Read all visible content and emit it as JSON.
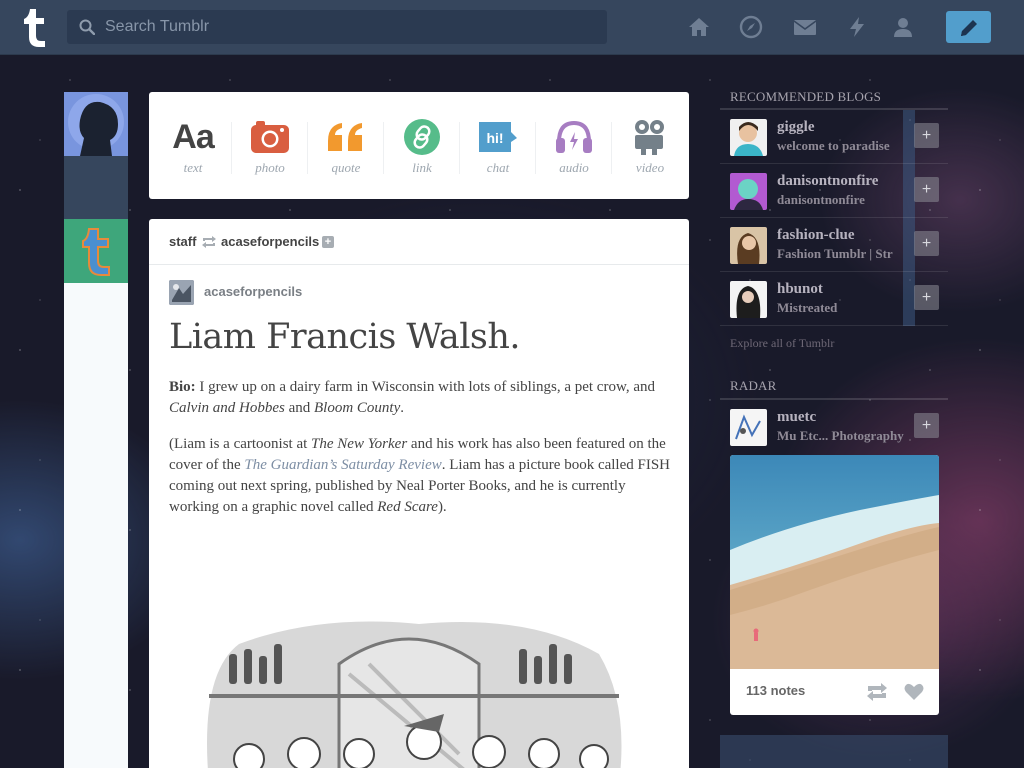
{
  "app": "Tumblr",
  "search": {
    "placeholder": "Search Tumblr"
  },
  "nav_icons": [
    "home-icon",
    "explore-compass-icon",
    "inbox-mail-icon",
    "activity-lightning-icon",
    "account-person-icon",
    "compose-pencil-icon"
  ],
  "colors": {
    "nav_bg": "#36465d",
    "accent_blue": "#529ecc",
    "text_orange": "#f2992e",
    "photo_red": "#d95e40",
    "link_green": "#56bc8a",
    "chat_blue": "#529ecc",
    "audio_purple": "#a77dc2",
    "video_gray": "#748089"
  },
  "post_types": [
    {
      "label": "text",
      "glyph": "Aa"
    },
    {
      "label": "photo"
    },
    {
      "label": "quote"
    },
    {
      "label": "link"
    },
    {
      "label": "chat",
      "glyph": "hi!"
    },
    {
      "label": "audio"
    },
    {
      "label": "video"
    }
  ],
  "post": {
    "reblogger": "staff",
    "reblogged_from": "acaseforpencils",
    "source": "acaseforpencils",
    "title": "Liam Francis Walsh.",
    "bio_label": "Bio:",
    "bio_text": "I grew up on a dairy farm in Wisconsin with lots of siblings, a pet crow, and",
    "bio_italic1": "Calvin and Hobbes",
    "bio_and": "and",
    "bio_italic2": "Bloom County",
    "bio_end": ".",
    "p2_a": "(Liam is a cartoonist at",
    "p2_italic1": "The New Yorker",
    "p2_b": "and his work has also been featured on the cover of the",
    "p2_link": "The Guardian’s Saturday Review",
    "p2_c": ". Liam has a picture book called FISH coming out next spring, published by Neal Porter Books, and he is currently working on a graphic novel called",
    "p2_italic2": "Red Scare",
    "p2_end": ")."
  },
  "sidebar": {
    "recommended_title": "RECOMMENDED BLOGS",
    "blogs": [
      {
        "name": "giggle",
        "sub": "welcome to paradise"
      },
      {
        "name": "danisontnonfire",
        "sub": "danisontnonfire"
      },
      {
        "name": "fashion-clue",
        "sub": "Fashion Tumblr | Str"
      },
      {
        "name": "hbunot",
        "sub": "Mistreated"
      }
    ],
    "explore": "Explore all of Tumblr",
    "radar_title": "RADAR",
    "radar": {
      "name": "muetc",
      "sub": "Mu Etc... Photography",
      "notes": "113 notes"
    }
  }
}
